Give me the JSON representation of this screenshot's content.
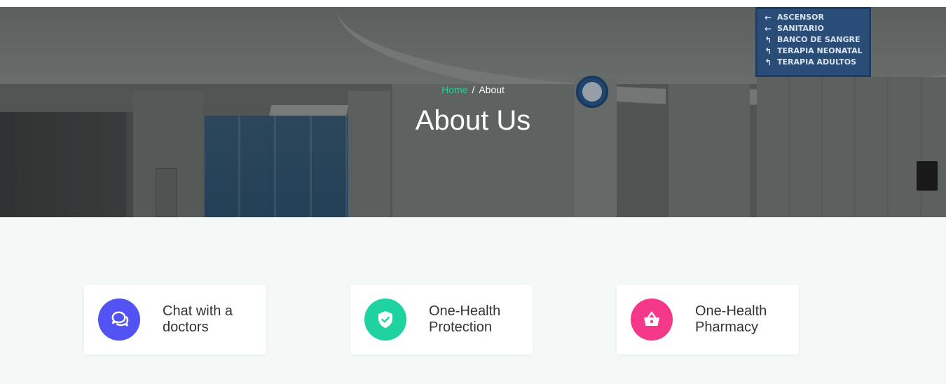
{
  "breadcrumb": {
    "home": "Home",
    "separator": "/",
    "current": "About"
  },
  "page_title": "About Us",
  "hero_sign": {
    "lines": [
      {
        "arrow": "←",
        "text": "ASCENSOR"
      },
      {
        "arrow": "←",
        "text": "SANITARIO"
      },
      {
        "arrow": "↰",
        "text": "BANCO DE SANGRE"
      },
      {
        "arrow": "↰",
        "text": "TERAPIA NEONATAL"
      },
      {
        "arrow": "↰",
        "text": "TERAPIA ADULTOS"
      }
    ]
  },
  "features": [
    {
      "label": "Chat with a doctors",
      "icon": "chat-bubbles-icon",
      "color": "#5352f3"
    },
    {
      "label": "One-Health Protection",
      "icon": "shield-check-icon",
      "color": "#1ed3a0"
    },
    {
      "label": "One-Health Pharmacy",
      "icon": "shopping-basket-icon",
      "color": "#f5398a"
    }
  ],
  "colors": {
    "accent_green": "#1ed3a0",
    "section_bg": "#f4f8f6"
  }
}
